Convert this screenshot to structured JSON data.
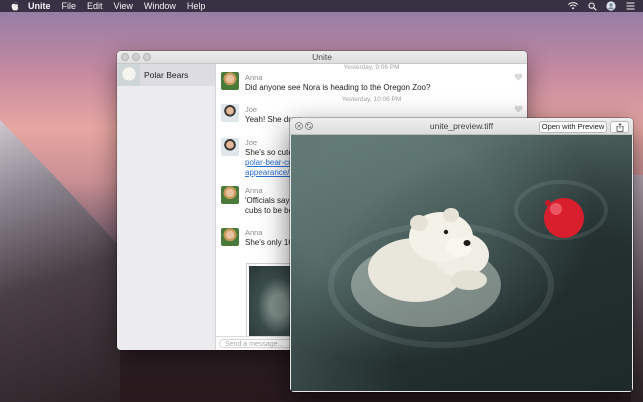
{
  "menubar": {
    "app_name": "Unite",
    "items": [
      "File",
      "Edit",
      "View",
      "Window",
      "Help"
    ]
  },
  "unite_window": {
    "title": "Unite",
    "sidebar": {
      "chats": [
        {
          "label": "Polar Bears"
        }
      ]
    },
    "messages": [
      {
        "timestamp": "Yesterday, 9:06 PM",
        "sender": "Anna",
        "lines": [
          "Did anyone see Nora is heading to the Oregon Zoo?"
        ]
      },
      {
        "timestamp": "Yesterday, 10:06 PM",
        "sender": "Joe",
        "lines": [
          "Yeah! She drew"
        ]
      },
      {
        "sender": "Joe",
        "lines": [
          "She's so cute! C"
        ],
        "link_lines": [
          "polar-bear-cub",
          "appearance/31"
        ]
      },
      {
        "sender": "Anna",
        "lines": [
          "'Officials say h",
          "cubs to be born"
        ]
      },
      {
        "sender": "Anna",
        "lines": [
          "She's only 10 m"
        ]
      }
    ],
    "composer_placeholder": "Send a message..."
  },
  "preview_window": {
    "title": "unite_preview.tiff",
    "open_button_label": "Open with Preview"
  },
  "colors": {
    "link": "#2a6fd6",
    "ball": "#d91f2e"
  },
  "icons": [
    "apple-icon",
    "wifi-icon",
    "search-icon",
    "user-icon",
    "menu-list-icon",
    "heart-icon",
    "close-icon",
    "fullscreen-icon",
    "share-icon"
  ]
}
